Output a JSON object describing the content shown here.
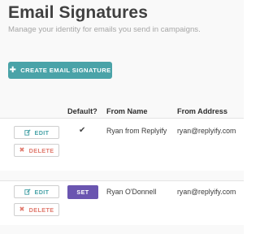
{
  "header": {
    "title": "Email Signatures",
    "subtitle": "Manage your identity for emails you send in campaigns."
  },
  "toolbar": {
    "create_label": "CREATE EMAIL SIGNATURE",
    "create_icon": "plus-icon"
  },
  "table": {
    "columns": [
      "",
      "Default?",
      "From Name",
      "From Address"
    ],
    "rows": [
      {
        "edit_label": "EDIT",
        "delete_label": "DELETE",
        "default": "✔",
        "is_default": true,
        "from_name": "Ryan from Replyify",
        "from_address": "ryan@replyify.com"
      },
      {
        "edit_label": "EDIT",
        "delete_label": "DELETE",
        "set_label": "SET",
        "is_default": false,
        "from_name": "Ryan O'Donnell",
        "from_address": "ryan@replyify.com"
      }
    ]
  },
  "colors": {
    "accent": "#4aa3a8",
    "set_button": "#6a55b0",
    "delete_text": "#e07a6e",
    "page_background": "#f9f9f9"
  }
}
